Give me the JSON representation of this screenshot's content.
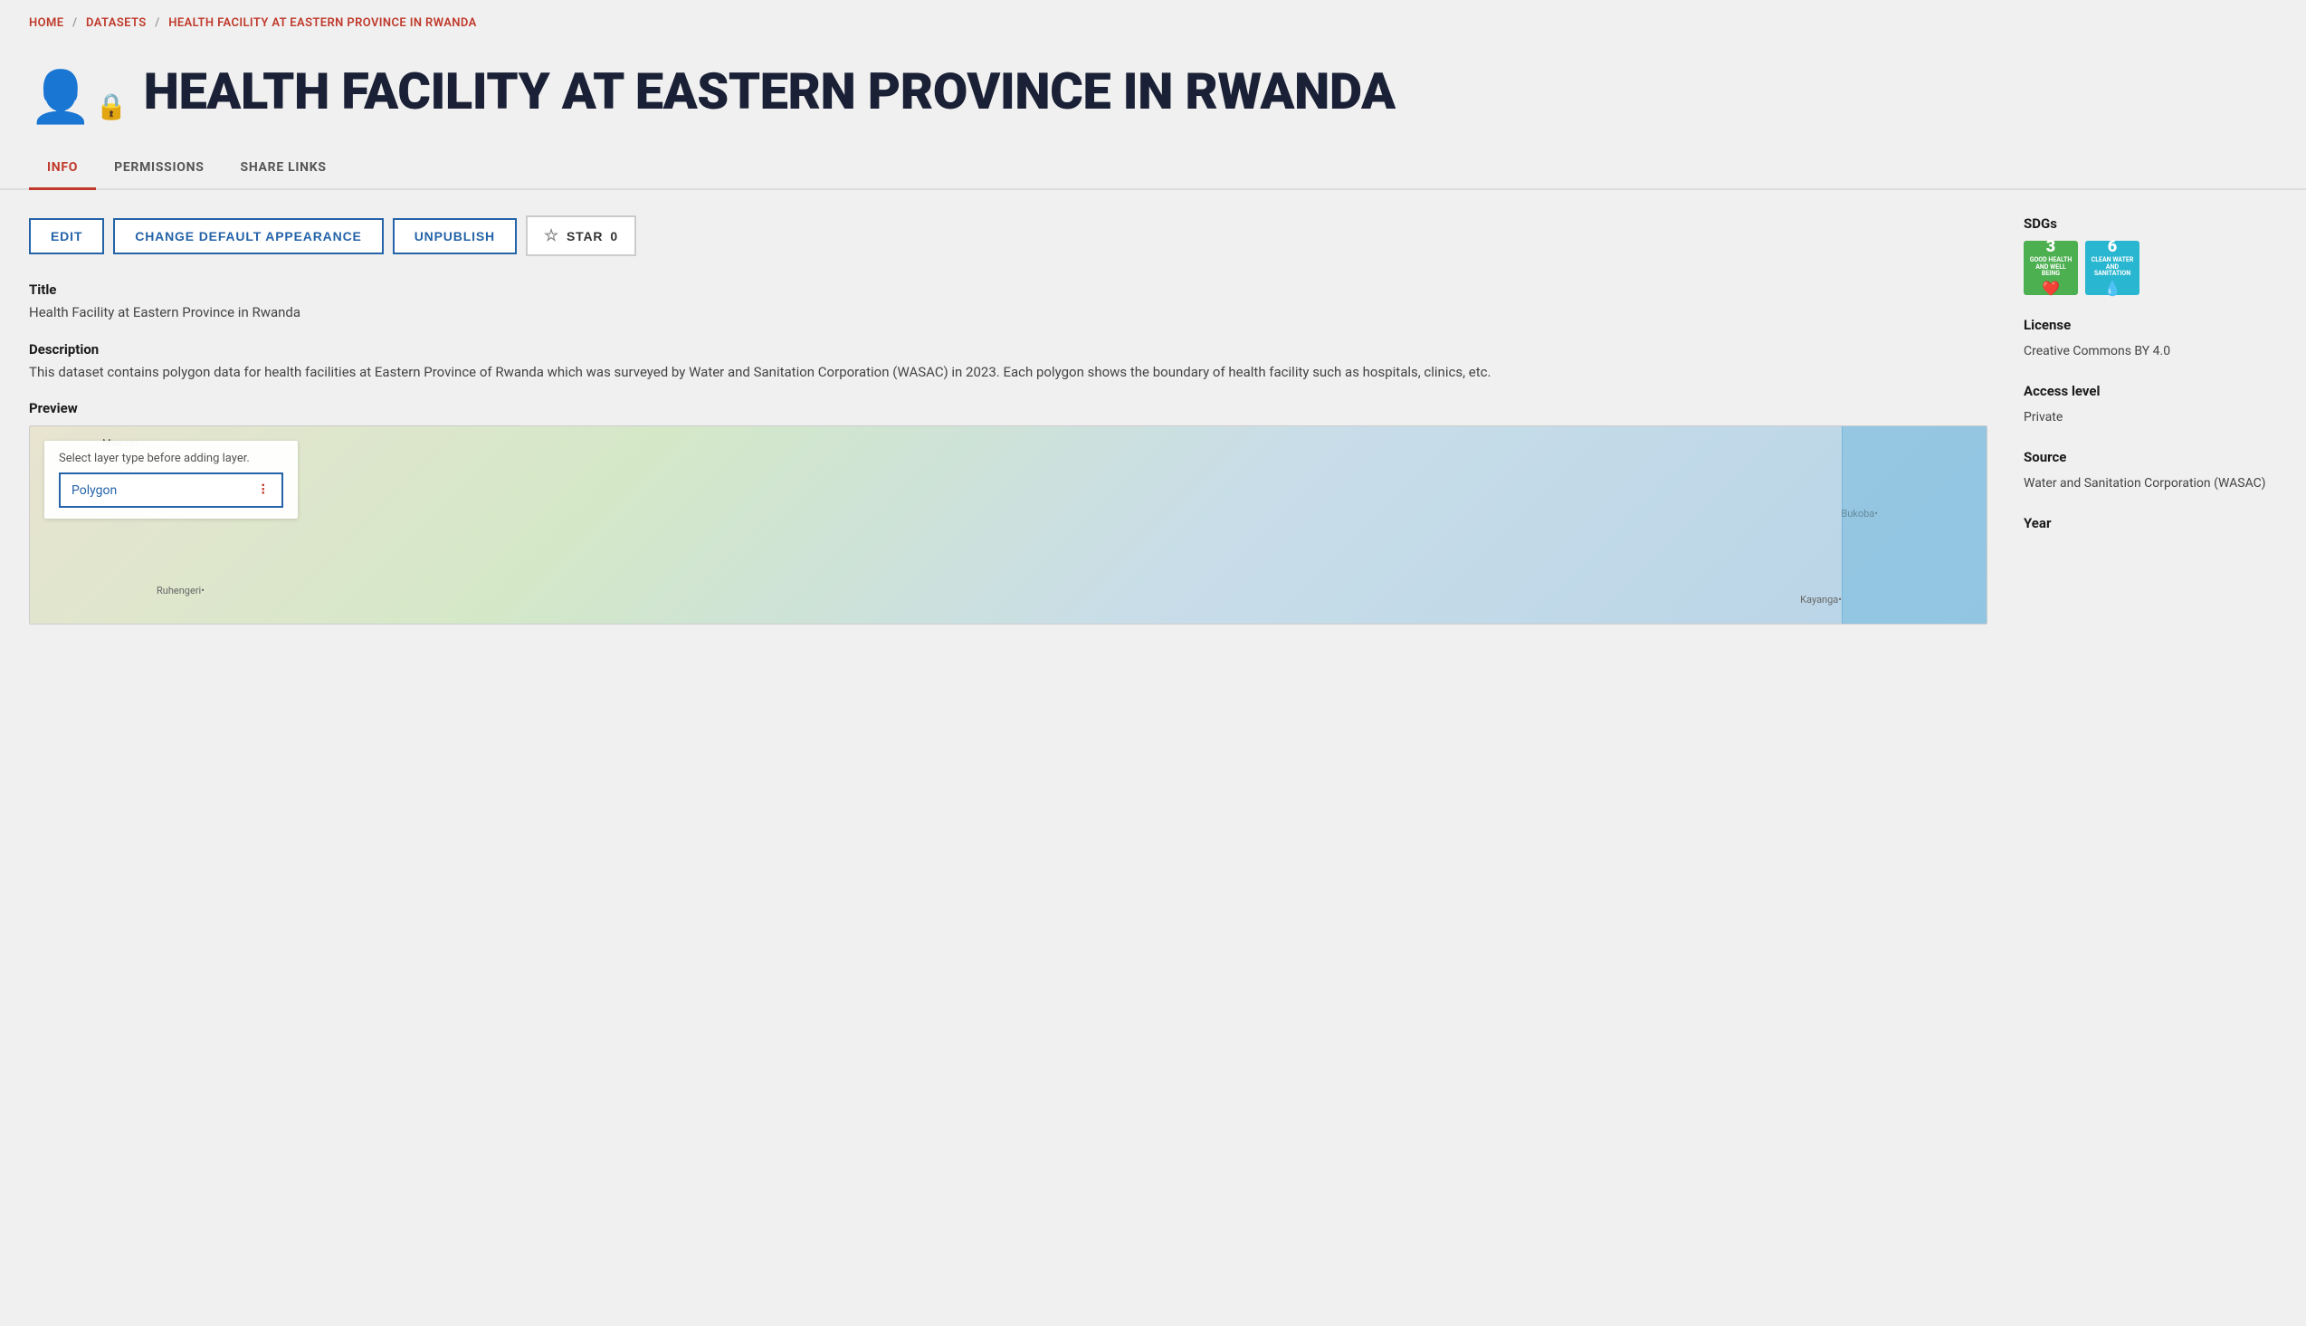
{
  "breadcrumb": {
    "home": "HOME",
    "sep1": "/",
    "datasets": "DATASETS",
    "sep2": "/",
    "current": "HEALTH FACILITY AT EASTERN PROVINCE IN RWANDA"
  },
  "header": {
    "title": "HEALTH FACILITY AT EASTERN PROVINCE IN RWANDA"
  },
  "tabs": [
    {
      "id": "info",
      "label": "INFO",
      "active": true
    },
    {
      "id": "permissions",
      "label": "PERMISSIONS",
      "active": false
    },
    {
      "id": "share-links",
      "label": "SHARE LINKS",
      "active": false
    }
  ],
  "buttons": {
    "edit": "EDIT",
    "change_appearance": "CHANGE DEFAULT APPEARANCE",
    "unpublish": "UNPUBLISH",
    "star": "STAR",
    "star_count": "0"
  },
  "fields": {
    "title_label": "Title",
    "title_value": "Health Facility at Eastern Province in Rwanda",
    "description_label": "Description",
    "description_value": "This dataset contains polygon data for health facilities at Eastern Province of Rwanda which was surveyed by Water and Sanitation Corporation (WASAC) in 2023. Each polygon shows the boundary of health facility such as hospitals, clinics, etc.",
    "preview_label": "Preview"
  },
  "map": {
    "select_layer_hint": "Select layer type before adding layer.",
    "polygon_value": "Polygon",
    "label_mweso": "Mweso•",
    "label_ruhengeri": "Ruhengeri•",
    "label_bukoba": "Bukoba•",
    "label_kayanga": "Kayanga•"
  },
  "sidebar": {
    "sdgs_label": "SDGs",
    "sdg_3_number": "3",
    "sdg_3_text": "GOOD HEALTH AND WELL BEING",
    "sdg_6_number": "6",
    "sdg_6_text": "CLEAN WATER AND SANITATION",
    "license_label": "License",
    "license_value": "Creative Commons BY 4.0",
    "access_level_label": "Access level",
    "access_level_value": "Private",
    "source_label": "Source",
    "source_value": "Water and Sanitation Corporation (WASAC)",
    "year_label": "Year"
  }
}
